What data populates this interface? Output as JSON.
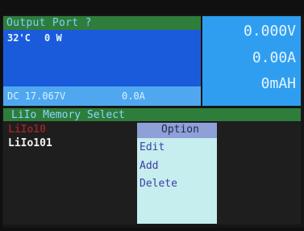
{
  "output": {
    "title": "Output Port ?",
    "temperature": "32'C",
    "power": "0 W",
    "dc_voltage": "DC 17.067V",
    "dc_current": "0.0A"
  },
  "readout": {
    "voltage": "0.000V",
    "current": "0.00A",
    "capacity": "0mAH"
  },
  "memory": {
    "title": "LiIo Memory Select",
    "items": [
      {
        "label": "LiIo10",
        "color": "#8e2525"
      },
      {
        "label": "LiIo101",
        "color": "#f3f3f3"
      }
    ]
  },
  "option_menu": {
    "title": "Option",
    "items": [
      {
        "label": "Edit"
      },
      {
        "label": "Add"
      },
      {
        "label": "Delete"
      }
    ]
  },
  "colors": {
    "header_green": "#2f7d3b",
    "output_blue": "#1a5bdc",
    "readout_blue": "#2f9ef0",
    "option_title": "#8fa0d8",
    "option_body": "#c7eeee"
  }
}
